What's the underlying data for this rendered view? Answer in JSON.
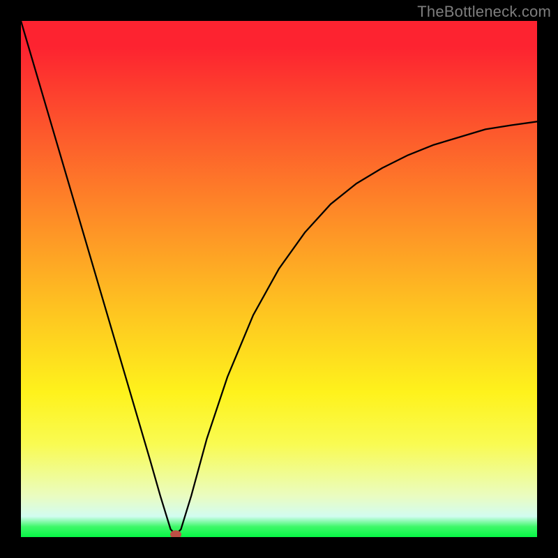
{
  "watermark": {
    "text": "TheBottleneck.com"
  },
  "chart_data": {
    "type": "line",
    "title": "",
    "xlabel": "",
    "ylabel": "",
    "ylim": [
      0,
      100
    ],
    "xlim": [
      0,
      100
    ],
    "x": [
      0,
      5,
      10,
      15,
      20,
      25,
      27,
      29,
      29.5,
      30,
      30.5,
      31,
      33,
      36,
      40,
      45,
      50,
      55,
      60,
      65,
      70,
      75,
      80,
      85,
      90,
      95,
      100
    ],
    "values": [
      100,
      83,
      66,
      49,
      32,
      15,
      8,
      1.5,
      1,
      0.5,
      1,
      1.5,
      8,
      19,
      31,
      43,
      52,
      59,
      64.5,
      68.5,
      71.5,
      74,
      76,
      77.5,
      79,
      79.8,
      80.5
    ],
    "marker": {
      "x": 30,
      "y": 0.5,
      "color": "#be4f45",
      "rx": 8,
      "ry": 6
    },
    "background_gradient": [
      {
        "stop": 0.0,
        "color": "#fd2330"
      },
      {
        "stop": 0.22,
        "color": "#fd5a2c"
      },
      {
        "stop": 0.38,
        "color": "#fe8c27"
      },
      {
        "stop": 0.55,
        "color": "#fec121"
      },
      {
        "stop": 0.72,
        "color": "#fef21c"
      },
      {
        "stop": 0.82,
        "color": "#f9fb52"
      },
      {
        "stop": 0.92,
        "color": "#eafcc0"
      },
      {
        "stop": 0.96,
        "color": "#d2fcf1"
      },
      {
        "stop": 0.98,
        "color": "#3ef869"
      },
      {
        "stop": 1.0,
        "color": "#06f745"
      }
    ]
  }
}
